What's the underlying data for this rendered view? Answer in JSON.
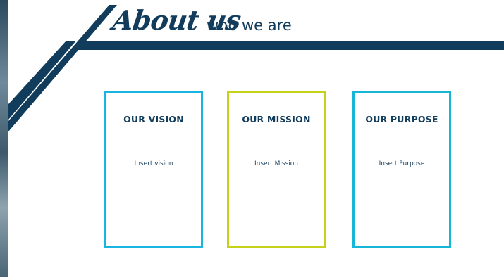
{
  "header": {
    "title": "About us",
    "subtitle": "who we are"
  },
  "cards": [
    {
      "title": "OUR VISION",
      "body": "Insert vision",
      "border_color": "#1ab4e0"
    },
    {
      "title": "OUR MISSION",
      "body": "Insert Mission",
      "border_color": "#c6d21a"
    },
    {
      "title": "OUR PURPOSE",
      "body": "Insert Purpose",
      "border_color": "#18b6d6"
    }
  ],
  "colors": {
    "brand_navy": "#123c5c",
    "background": "#ffffff"
  }
}
